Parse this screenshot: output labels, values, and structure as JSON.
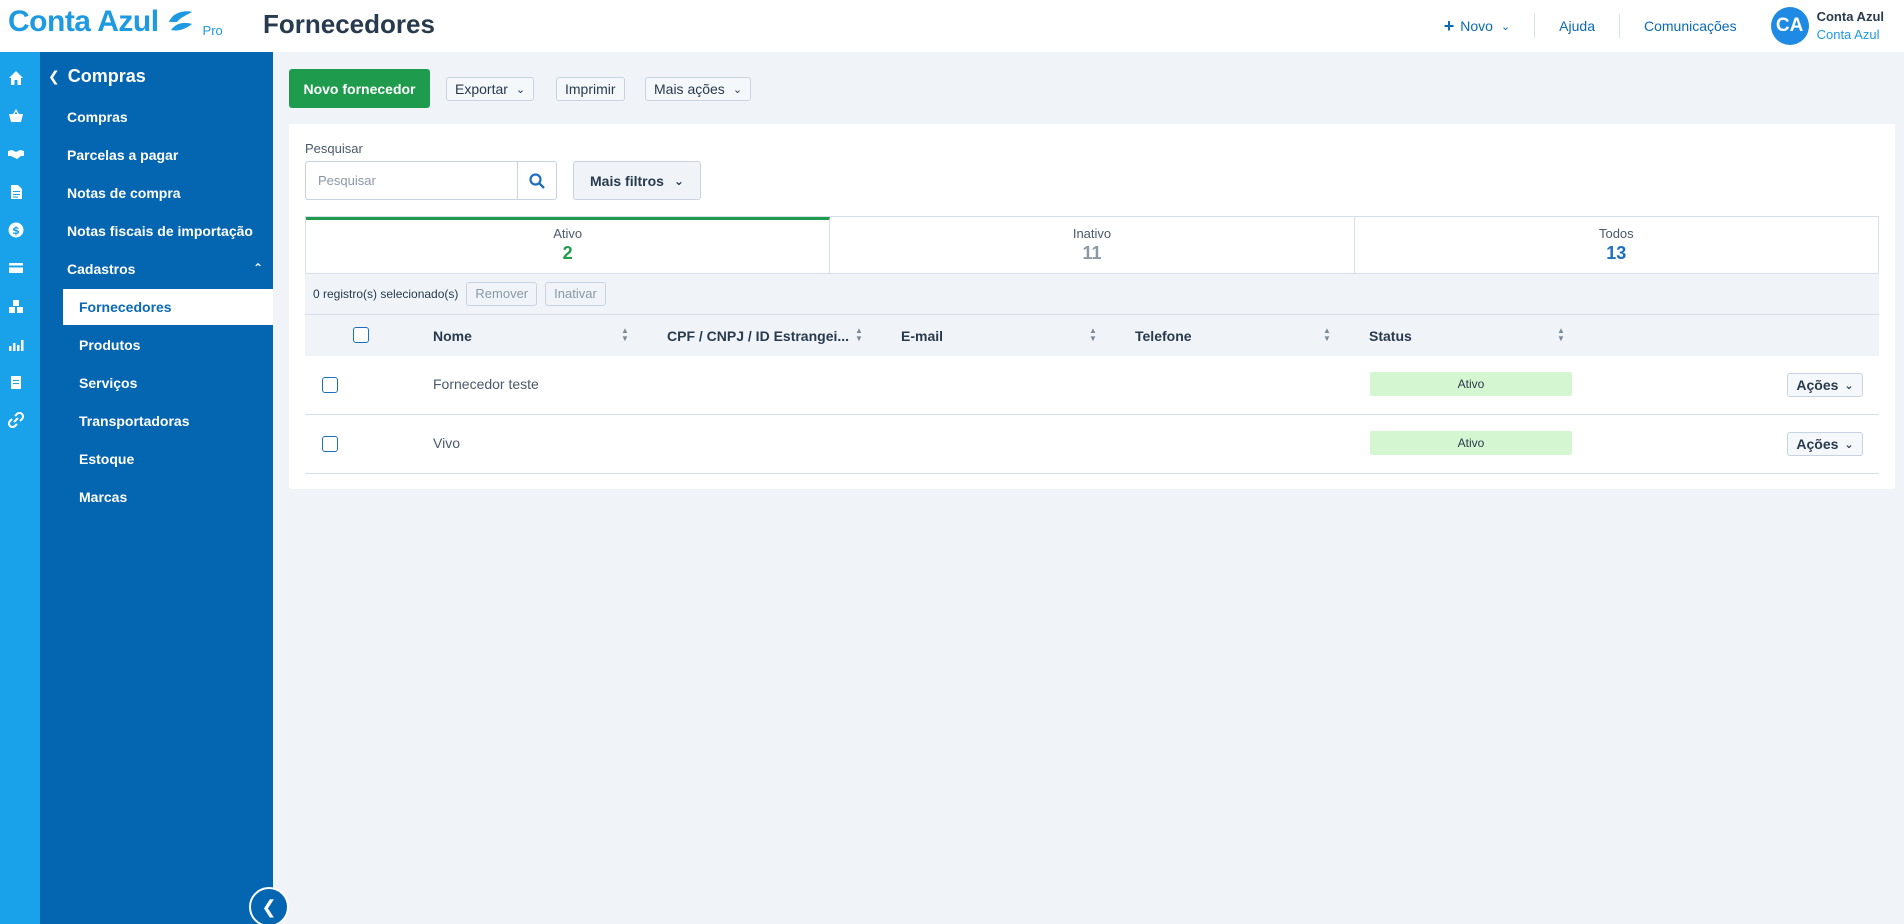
{
  "header": {
    "logo_text": "Conta Azul",
    "logo_badge": "Pro",
    "title": "Fornecedores",
    "new_label": "Novo",
    "help_label": "Ajuda",
    "comms_label": "Comunicações",
    "avatar_initials": "CA",
    "company": "Conta Azul",
    "user_name": "Conta Azul"
  },
  "rail": {
    "icons": [
      "home-icon",
      "basket-icon",
      "handshake-icon",
      "document-icon",
      "dollar-icon",
      "card-icon",
      "boxes-icon",
      "chart-icon",
      "clipboard-icon",
      "link-icon"
    ]
  },
  "sidebar": {
    "back_label": "Compras",
    "items": [
      "Compras",
      "Parcelas a pagar",
      "Notas de compra",
      "Notas fiscais de importação",
      "Cadastros"
    ],
    "sub_items": [
      "Fornecedores",
      "Produtos",
      "Serviços",
      "Transportadoras",
      "Estoque",
      "Marcas"
    ],
    "active": "Fornecedores"
  },
  "toolbar": {
    "new_supplier": "Novo fornecedor",
    "export": "Exportar",
    "print": "Imprimir",
    "more_actions": "Mais ações"
  },
  "search": {
    "label": "Pesquisar",
    "placeholder": "Pesquisar",
    "more_filters": "Mais filtros"
  },
  "tabs": [
    {
      "label": "Ativo",
      "count": "2",
      "color": "#1e9b4c"
    },
    {
      "label": "Inativo",
      "count": "11",
      "color": "#8a98a6"
    },
    {
      "label": "Todos",
      "count": "13",
      "color": "#1e6fc0"
    }
  ],
  "selection": {
    "text": "0 registro(s) selecionado(s)",
    "remove": "Remover",
    "deactivate": "Inativar"
  },
  "table": {
    "columns": [
      "Nome",
      "CPF / CNPJ / ID Estrangei...",
      "E-mail",
      "Telefone",
      "Status"
    ],
    "rows": [
      {
        "name": "Fornecedor teste",
        "status": "Ativo",
        "action": "Ações"
      },
      {
        "name": "Vivo",
        "status": "Ativo",
        "action": "Ações"
      }
    ]
  },
  "colors": {
    "brand": "#1e9ae3",
    "sidebar": "#0465b1",
    "rail": "#19a2e9",
    "primary_button": "#1e9b4c",
    "status_active_bg": "#d4f7d2"
  }
}
